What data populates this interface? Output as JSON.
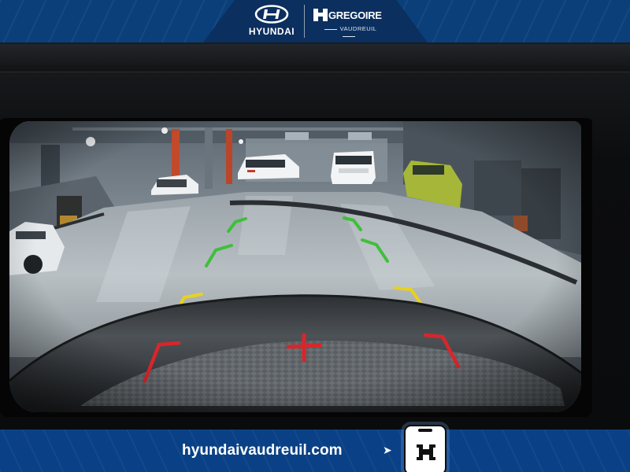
{
  "top_banner": {
    "brand_name": "HYUNDAI",
    "dealer_name": "GREGOIRE",
    "dealer_location": "VAUDREUIL",
    "icons": [
      "hyundai-logo-icon",
      "gregoire-h-icon"
    ]
  },
  "camera_view": {
    "guide_colors": {
      "near": "#d8262b",
      "mid": "#e8d21c",
      "far": "#3fbf3a",
      "center_mark": "#d8262b"
    },
    "background_scene": "dealership service garage"
  },
  "bottom_banner": {
    "website": "hyundaivaudreuil.com",
    "icons": [
      "chevron-right-icon",
      "phone-h-icon"
    ]
  },
  "colors": {
    "banner_blue": "#0a3f7a",
    "banner_dark": "#0b2f5e",
    "footer_blue": "#0a4186"
  }
}
